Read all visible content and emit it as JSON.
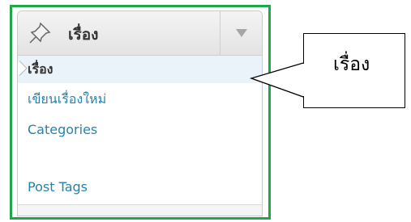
{
  "menu": {
    "header_label": "เรื่อง",
    "items": [
      {
        "label": "เรื่อง",
        "current": true
      },
      {
        "label": "เขียนเรื่องใหม่"
      },
      {
        "label": "Categories"
      },
      {
        "label": "Post Tags"
      }
    ]
  },
  "callout": {
    "text": "เรื่อง"
  },
  "icons": {
    "header": "pushpin-icon",
    "toggle": "dropdown-arrow-icon"
  },
  "colors": {
    "frame": "#1fa84a",
    "link": "#2583ad"
  }
}
